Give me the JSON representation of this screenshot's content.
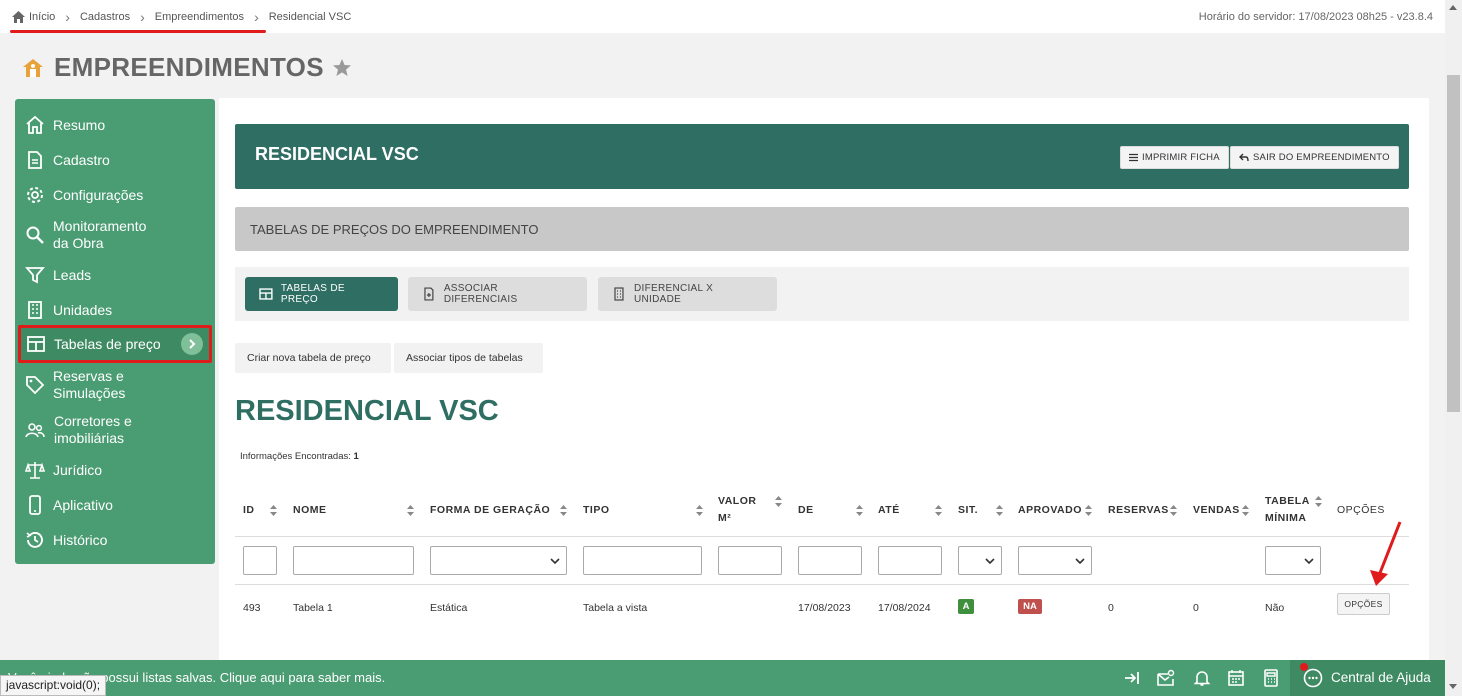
{
  "breadcrumb": {
    "items": [
      "Início",
      "Cadastros",
      "Empreendimentos",
      "Residencial VSC"
    ],
    "server_time": "Horário do servidor: 17/08/2023 08h25 - v23.8.4"
  },
  "page": {
    "title": "EMPREENDIMENTOS"
  },
  "sidebar": {
    "items": [
      {
        "label": "Resumo",
        "icon": "home-icon"
      },
      {
        "label": "Cadastro",
        "icon": "document-icon"
      },
      {
        "label": "Configurações",
        "icon": "gear-icon"
      },
      {
        "label": "Monitoramento da Obra",
        "icon": "search-icon"
      },
      {
        "label": "Leads",
        "icon": "filter-icon"
      },
      {
        "label": "Unidades",
        "icon": "building-icon"
      },
      {
        "label": "Tabelas de preço",
        "icon": "table-icon"
      },
      {
        "label": "Reservas e Simulações",
        "icon": "tag-icon"
      },
      {
        "label": "Corretores e imobiliárias",
        "icon": "users-icon"
      },
      {
        "label": "Jurídico",
        "icon": "scale-icon"
      },
      {
        "label": "Aplicativo",
        "icon": "phone-icon"
      },
      {
        "label": "Histórico",
        "icon": "history-icon"
      }
    ]
  },
  "header": {
    "title": "RESIDENCIAL VSC",
    "print_label": "IMPRIMIR FICHA",
    "exit_label": "SAIR DO EMPREENDIMENTO"
  },
  "section": {
    "title": "TABELAS DE PREÇOS DO EMPREENDIMENTO"
  },
  "tabs": [
    {
      "label": "TABELAS DE PREÇO",
      "active": true
    },
    {
      "label": "ASSOCIAR DIFERENCIAIS",
      "active": false
    },
    {
      "label": "DIFERENCIAL X UNIDADE",
      "active": false
    }
  ],
  "actions": {
    "create_label": "Criar nova tabela de preço",
    "associate_label": "Associar tipos de tabelas"
  },
  "content": {
    "title": "RESIDENCIAL VSC",
    "found_label": "Informações Encontradas:",
    "found_count": "1"
  },
  "table": {
    "headers": [
      "ID",
      "NOME",
      "FORMA DE GERAÇÃO",
      "TIPO",
      "VALOR M²",
      "DE",
      "ATÉ",
      "SIT.",
      "APROVADO",
      "RESERVAS",
      "VENDAS",
      "TABELA MÍNIMA",
      "OPÇÕES"
    ],
    "rows": [
      {
        "id": "493",
        "nome": "Tabela 1",
        "forma": "Estática",
        "tipo": "Tabela a vista",
        "valor_m2": "",
        "de": "17/08/2023",
        "ate": "17/08/2024",
        "sit": "A",
        "aprovado": "NA",
        "reservas": "0",
        "vendas": "0",
        "tabela_minima": "Não",
        "opcoes": "OPÇÕES"
      }
    ]
  },
  "bottom": {
    "message": "Você ainda não possui listas salvas. Clique aqui para saber mais.",
    "status_tip": "javascript:void(0);",
    "help_label": "Central de Ajuda"
  },
  "colors": {
    "primary": "#2f6e63",
    "sidebar": "#4a9c72",
    "highlight": "#e01b1b",
    "badge_a": "#3f8f3f",
    "badge_na": "#c0504d"
  }
}
